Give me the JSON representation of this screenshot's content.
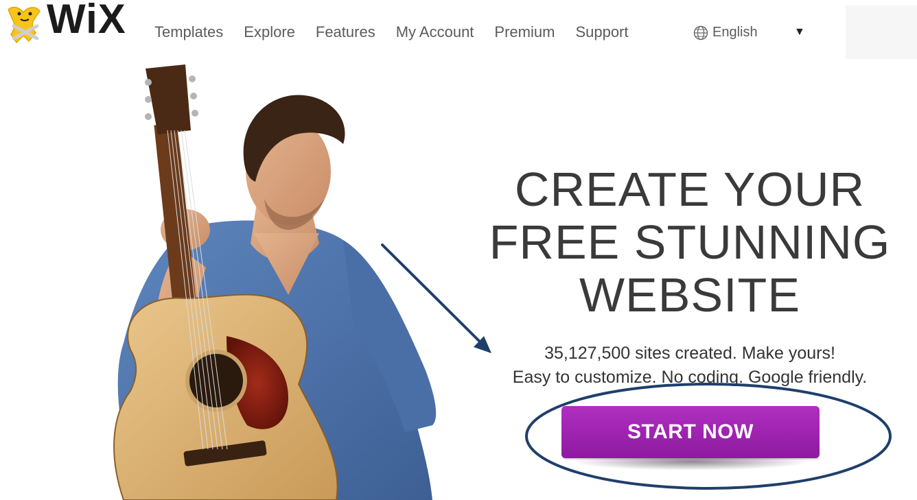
{
  "brand": {
    "name": "WiX"
  },
  "nav": {
    "items": [
      {
        "label": "Templates"
      },
      {
        "label": "Explore"
      },
      {
        "label": "Features"
      },
      {
        "label": "My Account"
      },
      {
        "label": "Premium"
      },
      {
        "label": "Support"
      }
    ],
    "language": {
      "label": "English",
      "icon": "globe-icon",
      "caret_icon": "caret-down-icon",
      "caret": "▼"
    }
  },
  "hero": {
    "headline": [
      "CREATE YOUR",
      "FREE STUNNING",
      "WEBSITE"
    ],
    "tagline": [
      "35,127,500 sites created. Make yours!",
      "Easy to customize. No coding. Google friendly."
    ],
    "cta_label": "START NOW"
  },
  "colors": {
    "cta": "#9b22b0",
    "annotation": "#1f3f6b",
    "text": "#3a3a3a",
    "nav_text": "#5b5b5b",
    "logo_yellow": "#f7c41b"
  }
}
